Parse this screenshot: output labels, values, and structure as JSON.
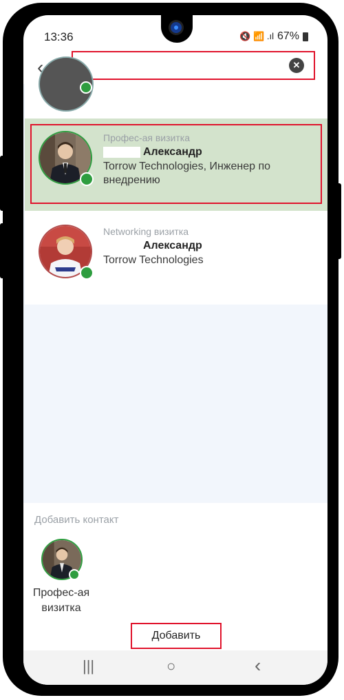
{
  "status_bar": {
    "time": "13:36",
    "icons": "🔇 📶 .ıl",
    "battery": "67%"
  },
  "search": {
    "value": "",
    "placeholder": ""
  },
  "contacts": [
    {
      "card_type": "Профес-ая визитка",
      "name": "Александр",
      "org": "Torrow Technologies, Инженер по внедрению",
      "selected": true
    },
    {
      "card_type": "Networking визитка",
      "name": "Александр",
      "org": "Torrow Technologies",
      "selected": false
    }
  ],
  "add_contact": {
    "title": "Добавить контакт",
    "selected_label": "Профес-ая визитка",
    "button_label": "Добавить"
  },
  "nav": {
    "recents": "|||",
    "home": "○",
    "back": "‹"
  }
}
